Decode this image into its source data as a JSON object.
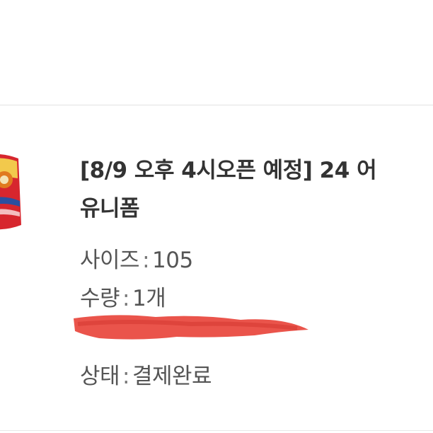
{
  "product": {
    "title_line1": "[8/9 오후 4시오픈 예정] 24 어",
    "title_line2": "유니폼",
    "thumbnail_icon": "uniform-thumbnail-icon"
  },
  "details": {
    "size_label": "사이즈",
    "size_value": "105",
    "quantity_label": "수량",
    "quantity_value": "1개",
    "status_label": "상태",
    "status_value": "결제완료",
    "separator": ":"
  },
  "colors": {
    "redaction": "#e8453c",
    "text_primary": "#333333",
    "text_secondary": "#555555"
  }
}
